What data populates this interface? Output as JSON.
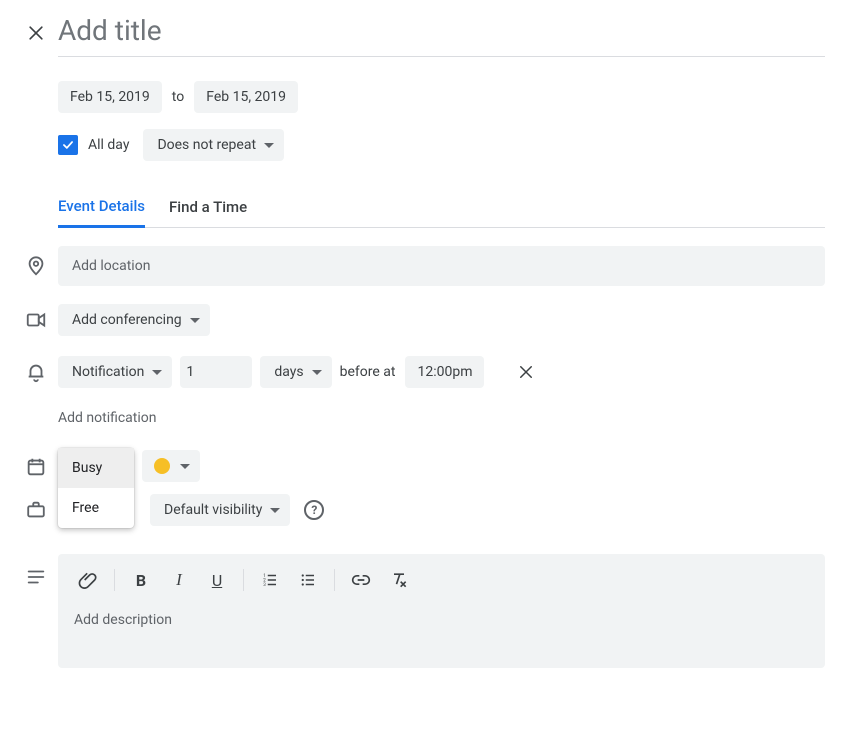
{
  "title": {
    "placeholder": "Add title"
  },
  "date": {
    "start": "Feb 15, 2019",
    "to": "to",
    "end": "Feb 15, 2019"
  },
  "allDay": {
    "label": "All day",
    "checked": true
  },
  "repeat": {
    "label": "Does not repeat"
  },
  "tabs": {
    "details": "Event Details",
    "findTime": "Find a Time"
  },
  "location": {
    "placeholder": "Add location"
  },
  "conferencing": {
    "label": "Add conferencing"
  },
  "notification": {
    "type": "Notification",
    "value": "1",
    "unit": "days",
    "beforeAt": "before at",
    "time": "12:00pm",
    "add": "Add notification"
  },
  "calendar": {
    "color": "#f6bf26"
  },
  "availability": {
    "options": {
      "busy": "Busy",
      "free": "Free"
    },
    "selected": "Busy"
  },
  "visibility": {
    "label": "Default visibility",
    "help": "?"
  },
  "description": {
    "placeholder": "Add description"
  }
}
